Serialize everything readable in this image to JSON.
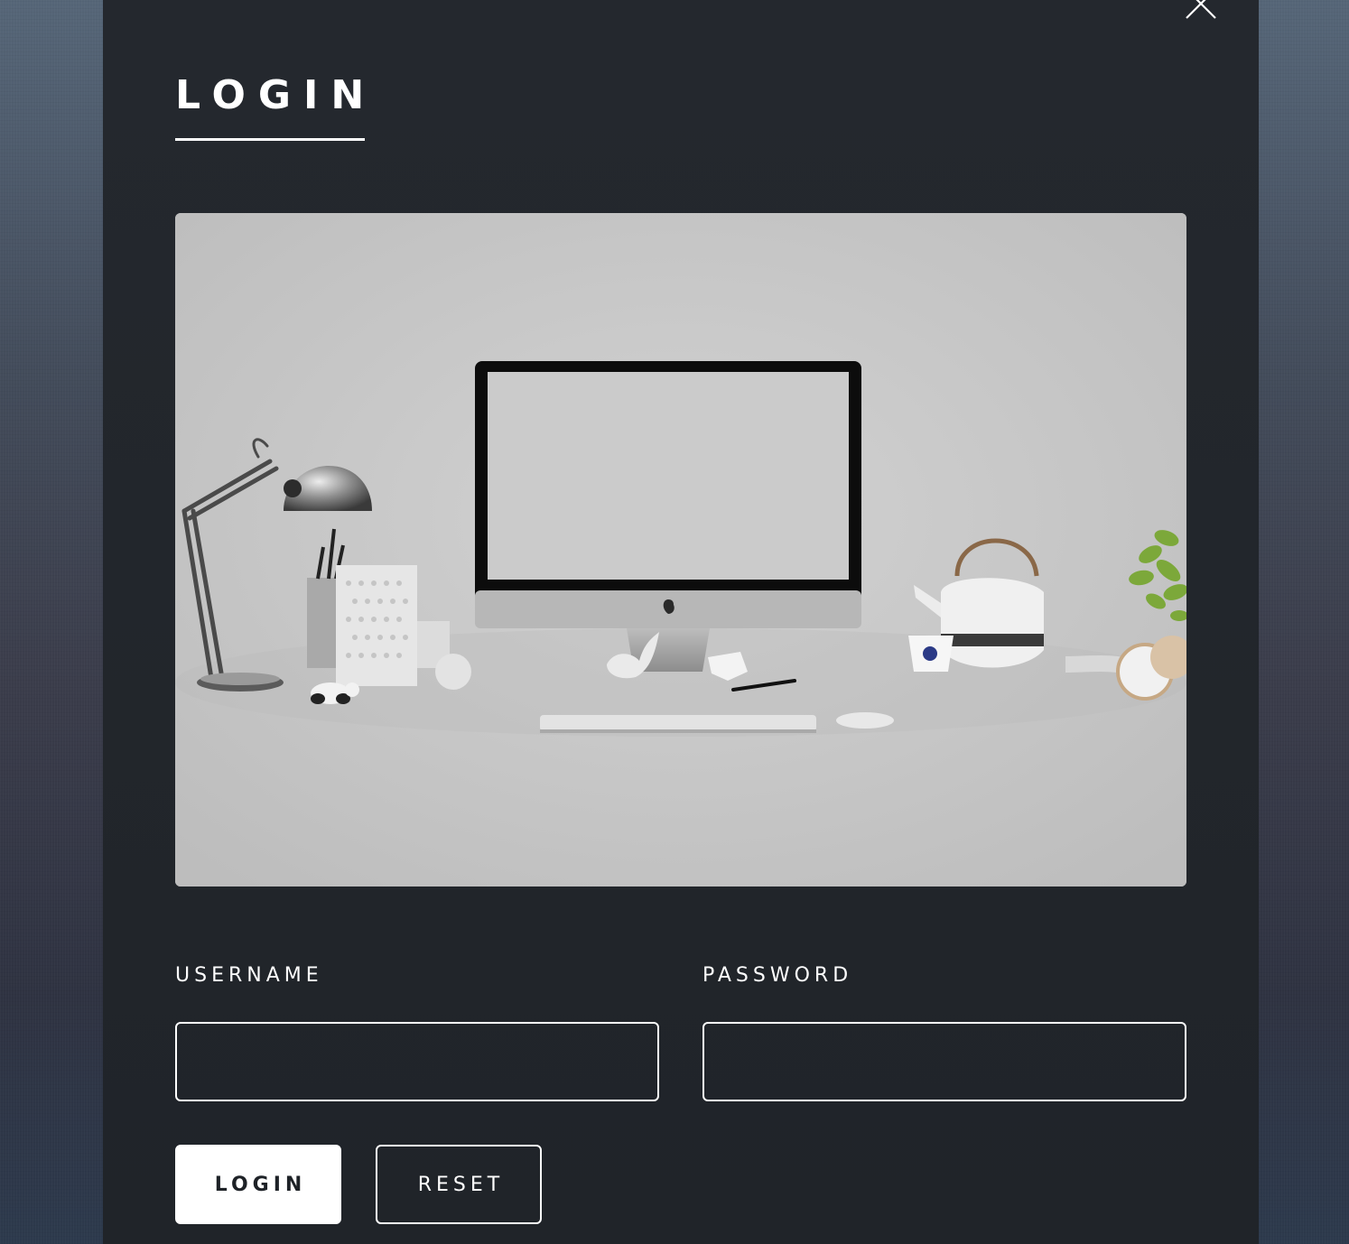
{
  "modal": {
    "title": "LOGIN",
    "close_icon": "close-icon",
    "hero_image": "desk-workspace-image"
  },
  "form": {
    "username_label": "USERNAME",
    "username_value": "",
    "password_label": "PASSWORD",
    "password_value": "",
    "login_button": "LOGIN",
    "reset_button": "RESET"
  },
  "colors": {
    "modal_background": "#22262b",
    "text": "#ffffff",
    "primary_button_background": "#ffffff",
    "primary_button_text": "#1e2227"
  }
}
